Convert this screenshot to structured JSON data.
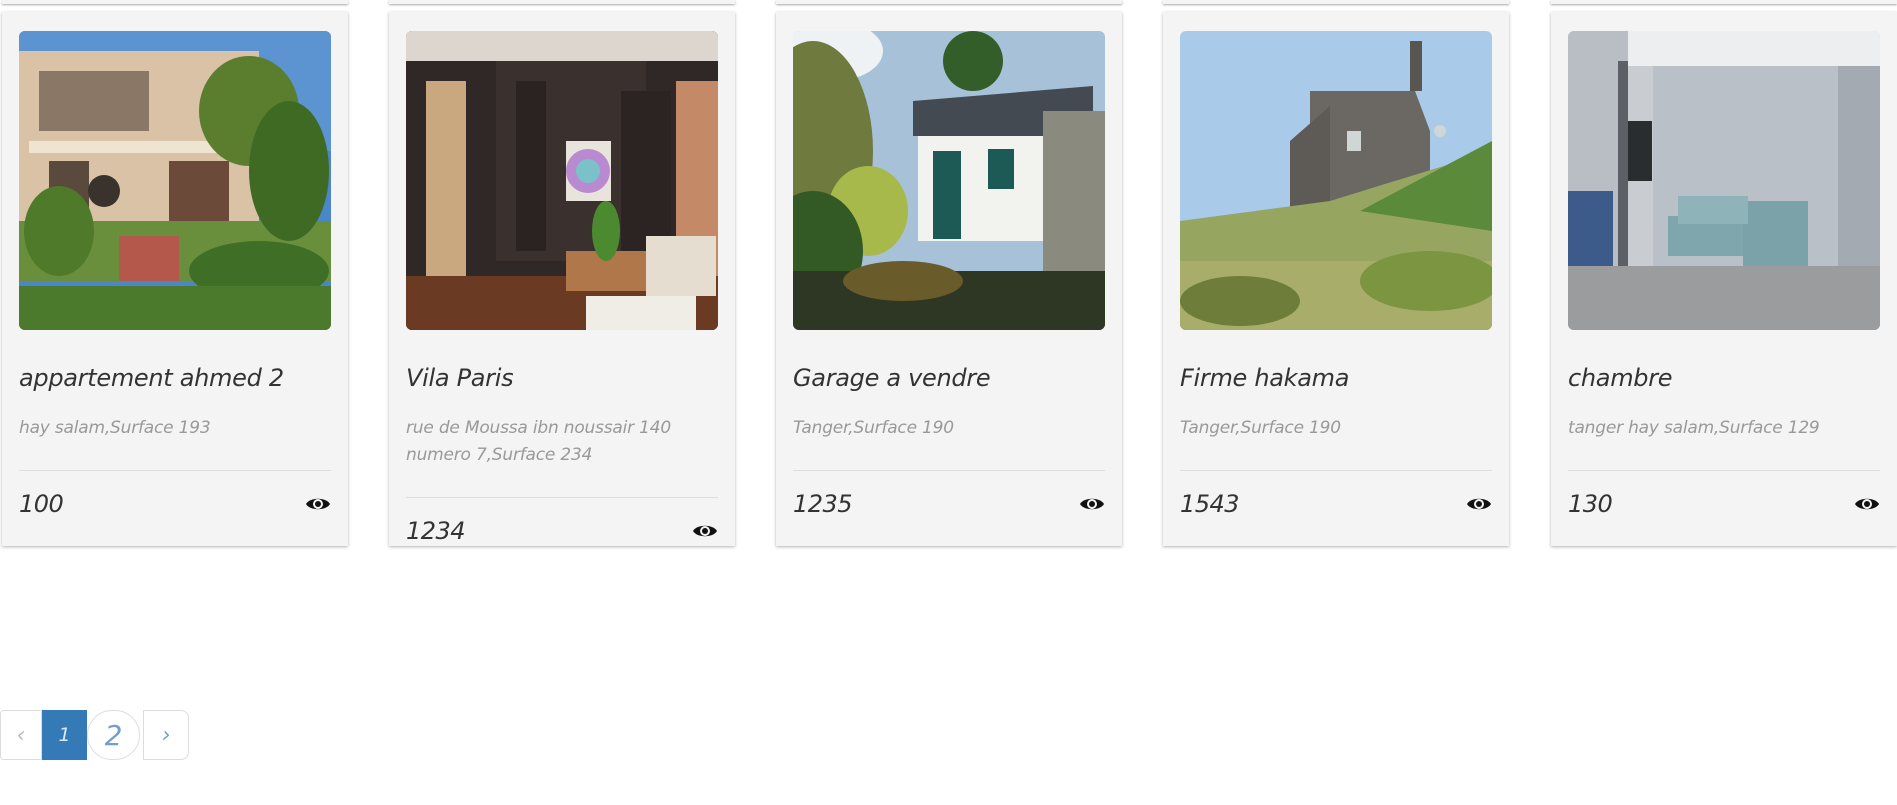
{
  "listings": [
    {
      "title": "appartement ahmed 2",
      "address": "hay salam,Surface 193",
      "price": "100",
      "image_alt": "house with garden"
    },
    {
      "title": "Vila Paris",
      "address": "rue de Moussa ibn noussair 140 numero 7,Surface 234",
      "price": "1234",
      "image_alt": "living room interior"
    },
    {
      "title": "Garage a vendre",
      "address": "Tanger,Surface 190",
      "price": "1235",
      "image_alt": "white shed in garden"
    },
    {
      "title": "Firme hakama",
      "address": "Tanger,Surface 190",
      "price": "1543",
      "image_alt": "shingled house in dunes"
    },
    {
      "title": "chambre",
      "address": "tanger hay salam,Surface 129",
      "price": "130",
      "image_alt": "room with blue sofa"
    }
  ],
  "pagination": {
    "prev": "‹",
    "pages": [
      "1",
      "2"
    ],
    "active": "1",
    "next": "›"
  },
  "icons": {
    "view": "eye-icon"
  },
  "colors": {
    "card_bg": "#f4f4f4",
    "active_page": "#337ab7",
    "link": "#6fa0cf"
  }
}
